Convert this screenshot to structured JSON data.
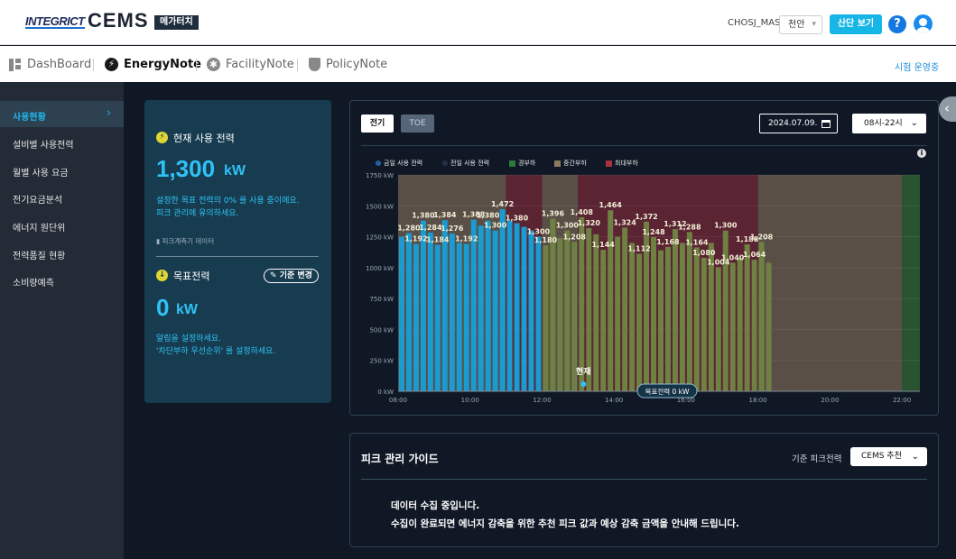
{
  "header": {
    "logo_brand": "INTEGRICT",
    "logo_product": "CEMS",
    "badge": "메가터치",
    "user_id": "CHOSJ_MAS",
    "site_select": "천안",
    "block_button": "산단 보기",
    "help_label": "?"
  },
  "nav": {
    "items": [
      {
        "label": "DashBoard",
        "icon": "dashboard-icon"
      },
      {
        "label": "EnergyNote",
        "icon": "bolt-icon",
        "active": true
      },
      {
        "label": "FacilityNote",
        "icon": "gear-icon"
      },
      {
        "label": "PolicyNote",
        "icon": "shield-icon"
      }
    ],
    "test_link": "시험 운영중"
  },
  "sidebar": {
    "items": [
      "사용현황",
      "설비별 사용전력",
      "월별 사용 요금",
      "전기요금분석",
      "에너지 원단위",
      "전력품질 현황",
      "소비량예측"
    ],
    "active_index": 0
  },
  "current_power": {
    "title": "현재 사용 전력",
    "value": "1,300",
    "unit": "kW",
    "note_line1": "설정한 목표 전력의 0% 를 사용 중이에요.",
    "note_line2": "피크 관리에 유의하세요.",
    "meter_data": "피크계측기 데이터"
  },
  "target_power": {
    "title": "목표전력",
    "change_button": "기준 변경",
    "value": "0",
    "unit": "kW",
    "note_line1": "알림을 설정하세요.",
    "note_line2": "'차단부하 우선순위' 를 설정하세요."
  },
  "chart_controls": {
    "tab_power": "전기",
    "tab_toe": "TOE",
    "date": "2024.07.09.",
    "time_range": "08시-22시",
    "info_icon": "i"
  },
  "chart_data": {
    "type": "bar",
    "legend": [
      "금일 사용 전력",
      "전일 사용 전력",
      "경부하",
      "중간부하",
      "최대부하"
    ],
    "colors": {
      "today": "#1a9bd1",
      "yesterday": "#6f8142",
      "light": "#2a5431",
      "mid": "#594f47",
      "peak": "#5a2433",
      "today_dot": "#1f63a5",
      "yesterday_dot": "#223048"
    },
    "ylim": [
      0,
      1750
    ],
    "y_ticks": [
      "0 kW",
      "250 kW",
      "500 kW",
      "750 kW",
      "1000 kW",
      "1250 kW",
      "1500 kW",
      "1750 kW"
    ],
    "x_ticks": [
      "08:00",
      "10:00",
      "12:00",
      "14:00",
      "16:00",
      "18:00",
      "20:00",
      "22:00"
    ],
    "x_range_hours": [
      8.0,
      22.5
    ],
    "bar_width_hours": 0.2,
    "load_bands": [
      {
        "from": 8.0,
        "to": 11.0,
        "type": "mid"
      },
      {
        "from": 11.0,
        "to": 12.0,
        "type": "peak"
      },
      {
        "from": 12.0,
        "to": 13.0,
        "type": "mid"
      },
      {
        "from": 13.0,
        "to": 18.0,
        "type": "peak"
      },
      {
        "from": 18.0,
        "to": 22.0,
        "type": "mid"
      },
      {
        "from": 22.0,
        "to": 22.5,
        "type": "light"
      }
    ],
    "today_values": [
      1250,
      1280,
      1192,
      1380,
      1284,
      1184,
      1384,
      1276,
      1200,
      1192,
      1388,
      1340,
      1380,
      1300,
      1472,
      1380,
      1360,
      1330,
      1300,
      1250
    ],
    "yesterday_values": [
      1180,
      1396,
      1240,
      1300,
      1208,
      1408,
      1320,
      1270,
      1144,
      1464,
      1250,
      1324,
      1200,
      1112,
      1372,
      1248,
      1140,
      1168,
      1312,
      1200,
      1288,
      1164,
      1080,
      1200,
      1004,
      1300,
      1040,
      1080,
      1188,
      1064,
      1208,
      1040
    ],
    "today_labels": [
      {
        "i": 1,
        "v": "1,280"
      },
      {
        "i": 2,
        "v": "1,192"
      },
      {
        "i": 3,
        "v": "1,380"
      },
      {
        "i": 4,
        "v": "1,284"
      },
      {
        "i": 5,
        "v": "1,184"
      },
      {
        "i": 6,
        "v": "1,384"
      },
      {
        "i": 7,
        "v": "1,276"
      },
      {
        "i": 9,
        "v": "1,192"
      },
      {
        "i": 10,
        "v": "1,388"
      },
      {
        "i": 12,
        "v": "1,380"
      },
      {
        "i": 13,
        "v": "1,300"
      },
      {
        "i": 14,
        "v": "1,472"
      },
      {
        "i": 16,
        "v": "1,380"
      },
      {
        "i": 19,
        "v": "1,300"
      }
    ],
    "yesterday_labels": [
      {
        "i": 0,
        "v": "1,180"
      },
      {
        "i": 1,
        "v": "1,396"
      },
      {
        "i": 3,
        "v": "1,300"
      },
      {
        "i": 4,
        "v": "1,208"
      },
      {
        "i": 5,
        "v": "1,408"
      },
      {
        "i": 6,
        "v": "1,320"
      },
      {
        "i": 8,
        "v": "1,144"
      },
      {
        "i": 9,
        "v": "1,464"
      },
      {
        "i": 11,
        "v": "1,324"
      },
      {
        "i": 13,
        "v": "1,112"
      },
      {
        "i": 14,
        "v": "1,372"
      },
      {
        "i": 15,
        "v": "1,248"
      },
      {
        "i": 17,
        "v": "1,168"
      },
      {
        "i": 18,
        "v": "1,312"
      },
      {
        "i": 20,
        "v": "1,288"
      },
      {
        "i": 21,
        "v": "1,164"
      },
      {
        "i": 22,
        "v": "1,080"
      },
      {
        "i": 24,
        "v": "1,004"
      },
      {
        "i": 25,
        "v": "1,300"
      },
      {
        "i": 26,
        "v": "1,040"
      },
      {
        "i": 28,
        "v": "1,188"
      },
      {
        "i": 29,
        "v": "1,064"
      },
      {
        "i": 30,
        "v": "1,208"
      }
    ],
    "current_marker": {
      "label": "현재",
      "hour": 13.1
    },
    "target_label": "목표전력 0 kW"
  },
  "guide": {
    "title": "피크 관리 가이드",
    "criteria_label": "기준 피크전력",
    "criteria_select": "CEMS 추천",
    "message_line1": "데이터 수집 중입니다.",
    "message_line2": "수집이 완료되면 에너지 감축을 위한 추천 피크 값과 예상 감축 금액을 안내해 드립니다."
  }
}
